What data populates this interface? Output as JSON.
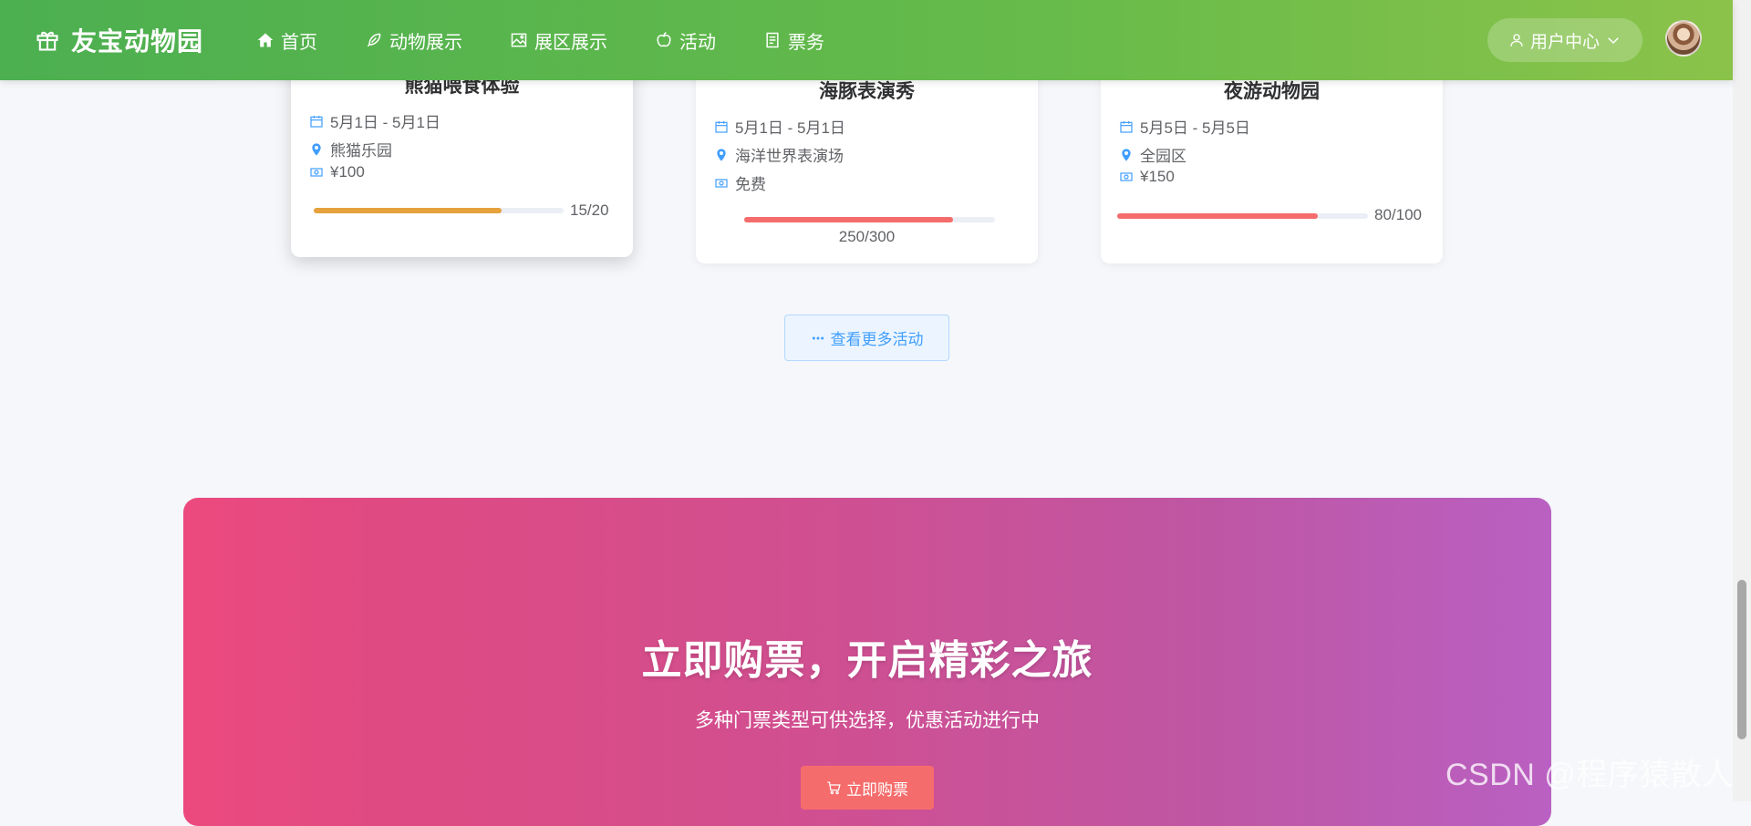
{
  "brand": {
    "title": "友宝动物园",
    "icon": "gift-icon"
  },
  "nav": [
    {
      "label": "首页",
      "icon": "home-icon"
    },
    {
      "label": "动物展示",
      "icon": "feather-icon"
    },
    {
      "label": "展区展示",
      "icon": "picture-icon"
    },
    {
      "label": "活动",
      "icon": "apple-icon"
    },
    {
      "label": "票务",
      "icon": "document-icon"
    }
  ],
  "user_center": {
    "label": "用户中心",
    "icon": "user-icon"
  },
  "activities": [
    {
      "title": "熊猫喂食体验",
      "date": "5月1日 - 5月1日",
      "location": "熊猫乐园",
      "price": "¥100",
      "enrolled": 15,
      "capacity": 20,
      "progress_text": "15/20",
      "color": "#e6a23c"
    },
    {
      "title": "海豚表演秀",
      "date": "5月1日 - 5月1日",
      "location": "海洋世界表演场",
      "price": "免费",
      "enrolled": 250,
      "capacity": 300,
      "progress_text": "250/300",
      "color": "#f56c6c"
    },
    {
      "title": "夜游动物园",
      "date": "5月5日 - 5月5日",
      "location": "全园区",
      "price": "¥150",
      "enrolled": 80,
      "capacity": 100,
      "progress_text": "80/100",
      "color": "#f56c6c"
    }
  ],
  "more_button": {
    "label": "查看更多活动"
  },
  "banner": {
    "title": "立即购票，开启精彩之旅",
    "subtitle": "多种门票类型可供选择，优惠活动进行中",
    "button_label": "立即购票"
  },
  "watermark": "CSDN @程序猿散人"
}
